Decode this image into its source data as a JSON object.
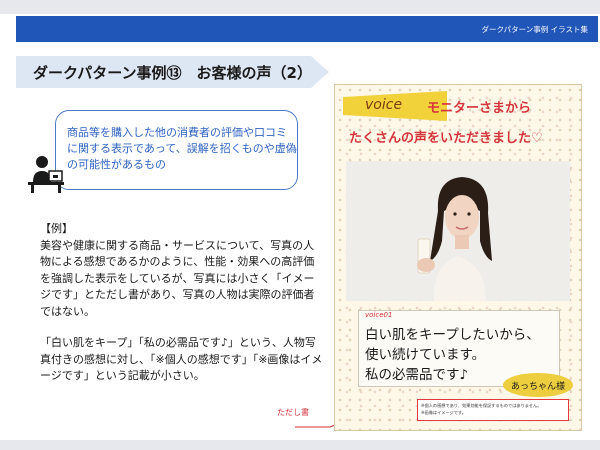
{
  "header": {
    "text": "ダークパターン事例 イラスト集"
  },
  "section_title": "ダークパターン事例⑬　お客様の声（2）",
  "definition": "商品等を購入した他の消費者の評価や口コミに関する表示であって、誤解を招くものや虚偽の可能性があるもの",
  "example": {
    "heading": "【例】",
    "paragraph1": "美容や健康に関する商品・サービスについて、写真の人物による感想であるかのように、性能・効果への高評価を強調した表示をしているが、写真には小さく「イメージです」とただし書があり、写真の人物は実際の評価者ではない。",
    "paragraph2": "「白い肌をキープ」「私の必需品です♪」という、人物写真付きの感想に対し、「※個人の感想です」「※画像はイメージです」という記載が小さい。"
  },
  "tadashi_label": "ただし書",
  "poster": {
    "voice_word": "voice",
    "headline1": "モニターさまから",
    "headline2": "たくさんの声をいただきました♡",
    "name_tag": "あっちゃん様",
    "voice_label": "voice01",
    "testimonial": [
      "白い肌をキープしたいから、",
      "使い続けています。",
      "私の必需品です♪"
    ],
    "disclaimer": [
      "※個人の感想であり、効果効能を保証するものではありません。",
      "※画像はイメージです。"
    ]
  },
  "colors": {
    "header_bar": "#1f56b8",
    "definition_text": "#2f63c1",
    "poster_red": "#d4343c",
    "accent_yellow": "#edce3e"
  },
  "icons": {
    "person": "person-at-desk-icon"
  }
}
